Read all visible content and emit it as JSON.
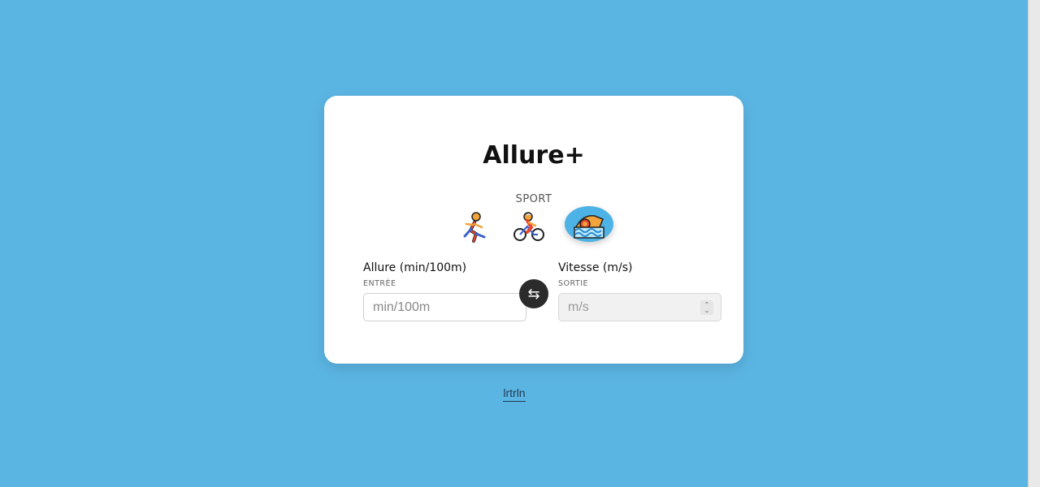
{
  "app": {
    "title": "Allure+",
    "sport_label": "SPORT",
    "sports": [
      {
        "name": "running",
        "icon": "runner-icon",
        "active": false
      },
      {
        "name": "cycling",
        "icon": "cyclist-icon",
        "active": false
      },
      {
        "name": "swimming",
        "icon": "swimmer-icon",
        "active": true
      }
    ]
  },
  "input_field": {
    "title": "Allure (min/100m)",
    "subtitle": "ENTRÉE",
    "placeholder": "min/100m",
    "value": ""
  },
  "output_field": {
    "title": "Vitesse (m/s)",
    "subtitle": "SORTIE",
    "placeholder": "m/s",
    "value": ""
  },
  "swap_button": {
    "icon": "swap-arrows-icon",
    "glyph": "⇆"
  },
  "footer": {
    "link_text": "lrtrln"
  },
  "colors": {
    "background": "#5bb5e3",
    "active_sport": "#4db2e6",
    "swap": "#2b2b2b"
  }
}
